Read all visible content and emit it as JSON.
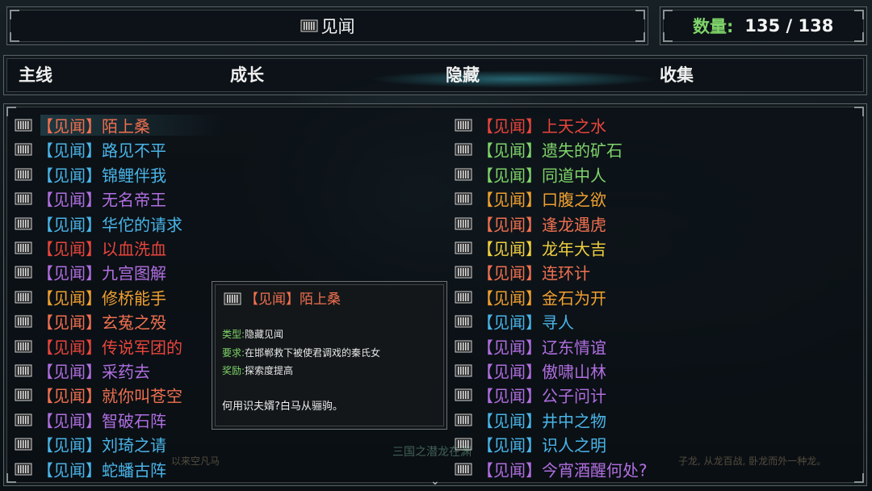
{
  "header": {
    "title": "见闻",
    "count_label": "数量:",
    "count_value": "135 / 138"
  },
  "tabs": [
    {
      "label": "主线"
    },
    {
      "label": "成长"
    },
    {
      "label": "隐藏",
      "active": true
    },
    {
      "label": "收集"
    }
  ],
  "entries_left": [
    {
      "prefix": "【见闻】",
      "name": "陌上桑",
      "color": "#f07050"
    },
    {
      "prefix": "【见闻】",
      "name": "路见不平",
      "color": "#4ab4e8"
    },
    {
      "prefix": "【见闻】",
      "name": "锦鲤伴我",
      "color": "#4ab4e8"
    },
    {
      "prefix": "【见闻】",
      "name": "无名帝王",
      "color": "#b06ee0"
    },
    {
      "prefix": "【见闻】",
      "name": "华佗的请求",
      "color": "#4ab4e8"
    },
    {
      "prefix": "【见闻】",
      "name": "以血洗血",
      "color": "#e8453c"
    },
    {
      "prefix": "【见闻】",
      "name": "九宫图解",
      "color": "#b06ee0"
    },
    {
      "prefix": "【见闻】",
      "name": "修桥能手",
      "color": "#f0a030"
    },
    {
      "prefix": "【见闻】",
      "name": "玄菟之殁",
      "color": "#f07050"
    },
    {
      "prefix": "【见闻】",
      "name": "传说军团的",
      "color": "#e8453c"
    },
    {
      "prefix": "【见闻】",
      "name": "采药去",
      "color": "#b06ee0"
    },
    {
      "prefix": "【见闻】",
      "name": "就你叫苍空",
      "color": "#f07050"
    },
    {
      "prefix": "【见闻】",
      "name": "智破石阵",
      "color": "#b06ee0"
    },
    {
      "prefix": "【见闻】",
      "name": "刘琦之请",
      "color": "#4ab4e8"
    },
    {
      "prefix": "【见闻】",
      "name": "蛇蟠古阵",
      "color": "#4ab4e8"
    }
  ],
  "entries_right": [
    {
      "prefix": "【见闻】",
      "name": "上天之水",
      "color": "#e8453c"
    },
    {
      "prefix": "【见闻】",
      "name": "遗失的矿石",
      "color": "#7fd46a"
    },
    {
      "prefix": "【见闻】",
      "name": "同道中人",
      "color": "#7fd46a"
    },
    {
      "prefix": "【见闻】",
      "name": "口腹之欲",
      "color": "#f0a030"
    },
    {
      "prefix": "【见闻】",
      "name": "逢龙遇虎",
      "color": "#f07050"
    },
    {
      "prefix": "【见闻】",
      "name": "龙年大吉",
      "color": "#f2d040"
    },
    {
      "prefix": "【见闻】",
      "name": "连环计",
      "color": "#f07050"
    },
    {
      "prefix": "【见闻】",
      "name": "金石为开",
      "color": "#f0a030"
    },
    {
      "prefix": "【见闻】",
      "name": "寻人",
      "color": "#4ab4e8"
    },
    {
      "prefix": "【见闻】",
      "name": "辽东情谊",
      "color": "#b06ee0"
    },
    {
      "prefix": "【见闻】",
      "name": "傲啸山林",
      "color": "#b06ee0"
    },
    {
      "prefix": "【见闻】",
      "name": "公子问计",
      "color": "#b06ee0"
    },
    {
      "prefix": "【见闻】",
      "name": "井中之物",
      "color": "#4ab4e8"
    },
    {
      "prefix": "【见闻】",
      "name": "识人之明",
      "color": "#4ab4e8"
    },
    {
      "prefix": "【见闻】",
      "name": "今宵酒醒何处?",
      "color": "#b06ee0"
    }
  ],
  "tooltip": {
    "title": "【见闻】陌上桑",
    "type_key": "类型:",
    "type_value": "隐藏见闻",
    "req_key": "要求:",
    "req_value": "在邯郸救下被使君调戏的秦氏女",
    "reward_key": "奖励:",
    "reward_value": "探索度提高",
    "flavor": "何用识夫婿?白马从骊驹。"
  },
  "footer": {
    "title": "三国之潜龙在渊",
    "left_text": "以来空凡马",
    "right_text": "子龙, 从龙百战, 卧龙而外一种龙。"
  },
  "colors": {
    "accent_green": "#7fd46a",
    "tab_glow": "#46c8dc"
  }
}
